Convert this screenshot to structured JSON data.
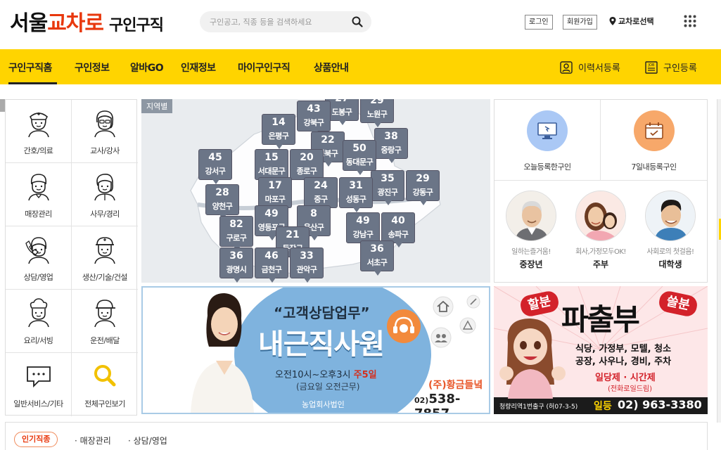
{
  "header": {
    "logo_part1": "서울",
    "logo_part2": "교차로",
    "logo_part3": "구인구직",
    "search_placeholder": "구인공고, 직종 등을 검색하세요",
    "login": "로그인",
    "signup": "회원가입",
    "location": "교차로선택"
  },
  "nav": {
    "items": [
      "구인구직홈",
      "구인정보",
      "알바GO",
      "인재정보",
      "마이구인구직",
      "상품안내"
    ],
    "resume": "이력서등록",
    "job_post": "구인등록",
    "job_icon_text": "JOB"
  },
  "categories": [
    {
      "label": "간호/의료",
      "icon": "nurse-icon"
    },
    {
      "label": "교사/강사",
      "icon": "teacher-icon"
    },
    {
      "label": "매장관리",
      "icon": "store-manager-icon"
    },
    {
      "label": "사무/경리",
      "icon": "office-worker-icon"
    },
    {
      "label": "상담/영업",
      "icon": "call-agent-icon"
    },
    {
      "label": "생산/기술/건설",
      "icon": "construction-worker-icon"
    },
    {
      "label": "요리/서빙",
      "icon": "chef-icon"
    },
    {
      "label": "운전/배달",
      "icon": "driver-icon"
    },
    {
      "label": "일반서비스/기타",
      "icon": "speech-bubble-icon"
    },
    {
      "label": "전체구인보기",
      "icon": "search-icon"
    }
  ],
  "map": {
    "tag": "지역별",
    "districts": [
      {
        "count": "27",
        "name": "도봉구"
      },
      {
        "count": "29",
        "name": "노원구"
      },
      {
        "count": "43",
        "name": "강북구"
      },
      {
        "count": "14",
        "name": "은평구"
      },
      {
        "count": "22",
        "name": "성북구"
      },
      {
        "count": "38",
        "name": "중랑구"
      },
      {
        "count": "45",
        "name": "강서구"
      },
      {
        "count": "15",
        "name": "서대문구"
      },
      {
        "count": "20",
        "name": "종로구"
      },
      {
        "count": "50",
        "name": "동대문구"
      },
      {
        "count": "35",
        "name": "광진구"
      },
      {
        "count": "29",
        "name": "강동구"
      },
      {
        "count": "28",
        "name": "양천구"
      },
      {
        "count": "17",
        "name": "마포구"
      },
      {
        "count": "24",
        "name": "중구"
      },
      {
        "count": "31",
        "name": "성동구"
      },
      {
        "count": "49",
        "name": "영등포구"
      },
      {
        "count": "8",
        "name": "용산구"
      },
      {
        "count": "82",
        "name": "구로구"
      },
      {
        "count": "21",
        "name": "동작구"
      },
      {
        "count": "49",
        "name": "강남구"
      },
      {
        "count": "40",
        "name": "송파구"
      },
      {
        "count": "36",
        "name": "광명시"
      },
      {
        "count": "46",
        "name": "금천구"
      },
      {
        "count": "33",
        "name": "관악구"
      },
      {
        "count": "36",
        "name": "서초구"
      }
    ]
  },
  "quick": {
    "today": "오늘등록한구인",
    "week": "7일내등록구인",
    "personas": [
      {
        "sub": "일하는즐거움!",
        "main": "중장년"
      },
      {
        "sub": "회사,가정모두OK!",
        "main": "주부"
      },
      {
        "sub": "사회로의 첫걸음!",
        "main": "대학생"
      }
    ]
  },
  "banner1": {
    "headline": "“고객상담업무”",
    "title": "내근직사원",
    "hours_prefix": "오전10시~오후3시 ",
    "hours_days": "주5일",
    "friday": "(금요일 오전근무)",
    "company_type": "농업회사법인",
    "company": "(주)황금들녘",
    "phone_area": "02)",
    "phone": "538-7857"
  },
  "banner2": {
    "left_badge": "할분",
    "right_badge": "쓸분",
    "title": "파출부",
    "line1": "식당, 가정부, 모텔, 청소",
    "line2": "공장, 사우나, 경비, 주차",
    "line3": "일당제 · 시간제",
    "line4": "(전화로일드림)",
    "address": "청량리역1번출구 (허07-3-5)",
    "daily": "일등",
    "phone": "02) 963-3380"
  },
  "popular": {
    "label": "인기직종",
    "items": [
      "· 매장관리",
      "· 상담/영업"
    ]
  },
  "colors": {
    "accent_yellow": "#ffd400",
    "brand_orange": "#e8380d",
    "pin_gray": "#6b7587"
  }
}
